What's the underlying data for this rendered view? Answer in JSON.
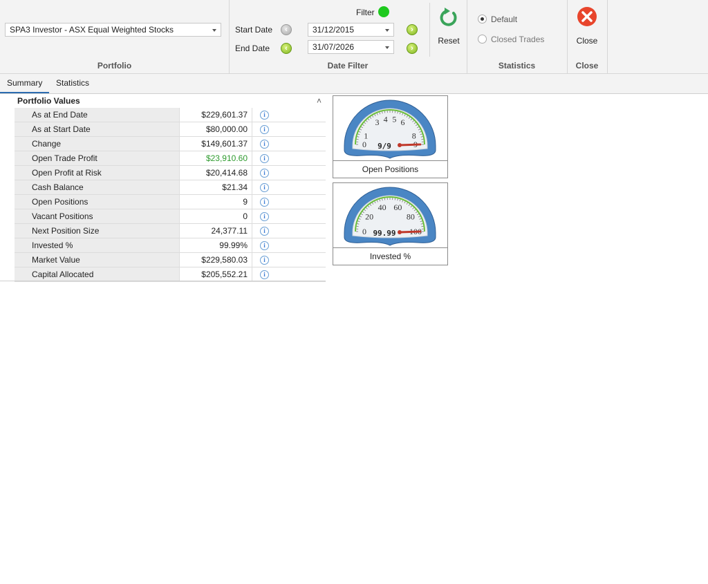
{
  "ribbon": {
    "portfolio": {
      "selected": "SPA3 Investor - ASX Equal Weighted Stocks",
      "group_label": "Portfolio"
    },
    "date_filter": {
      "filter_label": "Filter",
      "filter_status_color": "#1ec91e",
      "start_label": "Start Date",
      "start_value": "31/12/2015",
      "end_label": "End Date",
      "end_value": "31/07/2026",
      "reset_label": "Reset",
      "group_label": "Date Filter"
    },
    "statistics": {
      "default_label": "Default",
      "closed_trades_label": "Closed Trades",
      "default_selected": true,
      "group_label": "Statistics"
    },
    "close": {
      "button_label": "Close",
      "group_label": "Close"
    }
  },
  "tabs": [
    {
      "label": "Summary",
      "active": true
    },
    {
      "label": "Statistics",
      "active": false
    }
  ],
  "portfolio_values": {
    "title": "Portfolio Values",
    "rows": [
      {
        "name": "As at End Date",
        "value": "$229,601.37"
      },
      {
        "name": "As at Start Date",
        "value": "$80,000.00"
      },
      {
        "name": "Change",
        "value": "$149,601.37"
      },
      {
        "name": "Open Trade Profit",
        "value": "$23,910.60",
        "highlight": "#2e9b2e"
      },
      {
        "name": "Open Profit at Risk",
        "value": "$20,414.68"
      },
      {
        "name": "Cash Balance",
        "value": "$21.34"
      },
      {
        "name": "Open Positions",
        "value": "9"
      },
      {
        "name": "Vacant Positions",
        "value": "0"
      },
      {
        "name": "Next Position Size",
        "value": "24,377.11"
      },
      {
        "name": "Invested %",
        "value": "99.99%"
      },
      {
        "name": "Market Value",
        "value": "$229,580.03"
      },
      {
        "name": "Capital Allocated",
        "value": "$205,552.21"
      }
    ]
  },
  "gauges": [
    {
      "caption": "Open Positions",
      "readout": "9/9",
      "min": 0,
      "max": 9,
      "value": 9,
      "ticks": [
        "0",
        "1",
        "3",
        "4",
        "5",
        "6",
        "8",
        "9"
      ],
      "tick_values": [
        0,
        1,
        3,
        4,
        5,
        6,
        8,
        9
      ]
    },
    {
      "caption": "Invested %",
      "readout": "99.99",
      "min": 0,
      "max": 100,
      "value": 99.99,
      "ticks": [
        "0",
        "20",
        "40",
        "60",
        "80",
        "100"
      ],
      "tick_values": [
        0,
        20,
        40,
        60,
        80,
        100
      ]
    }
  ],
  "colors": {
    "accent": "#2b6cb0",
    "gauge_frame": "#4a86c4",
    "needle": "#c0392b",
    "close_red": "#e8452c",
    "reset_green": "#3aa45a"
  }
}
